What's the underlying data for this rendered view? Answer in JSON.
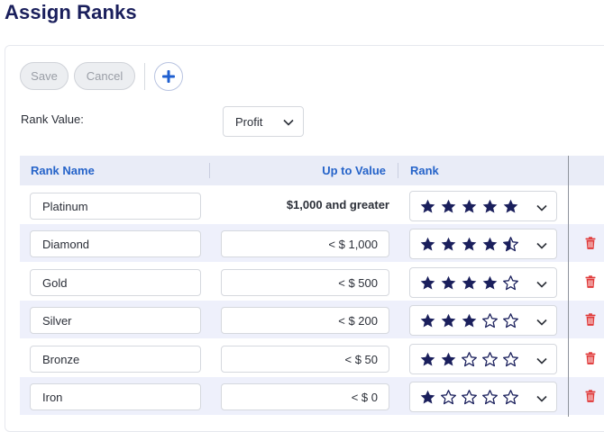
{
  "page": {
    "title": "Assign Ranks"
  },
  "toolbar": {
    "save_label": "Save",
    "cancel_label": "Cancel"
  },
  "rank_value": {
    "label": "Rank Value:",
    "selected": "Profit"
  },
  "table": {
    "headers": {
      "name": "Rank Name",
      "up_to": "Up to Value",
      "rank": "Rank"
    },
    "rows": [
      {
        "name": "Platinum",
        "value": "$1,000 and greater",
        "stars": 5
      },
      {
        "name": "Diamond",
        "value": "< $ 1,000",
        "stars": 4.5
      },
      {
        "name": "Gold",
        "value": "< $ 500",
        "stars": 4
      },
      {
        "name": "Silver",
        "value": "< $ 200",
        "stars": 3
      },
      {
        "name": "Bronze",
        "value": "< $ 50",
        "stars": 2
      },
      {
        "name": "Iron",
        "value": "< $ 0",
        "stars": 1
      }
    ]
  },
  "colors": {
    "accent": "#2563c9",
    "title": "#1a1f5c",
    "star": "#1a1f5c",
    "trash": "#e03a3a",
    "row_alt": "#eef0fb"
  },
  "icons": {
    "add": "plus-icon",
    "dropdown": "chevron-down-icon",
    "delete": "trash-icon",
    "rating": "star-icon"
  }
}
